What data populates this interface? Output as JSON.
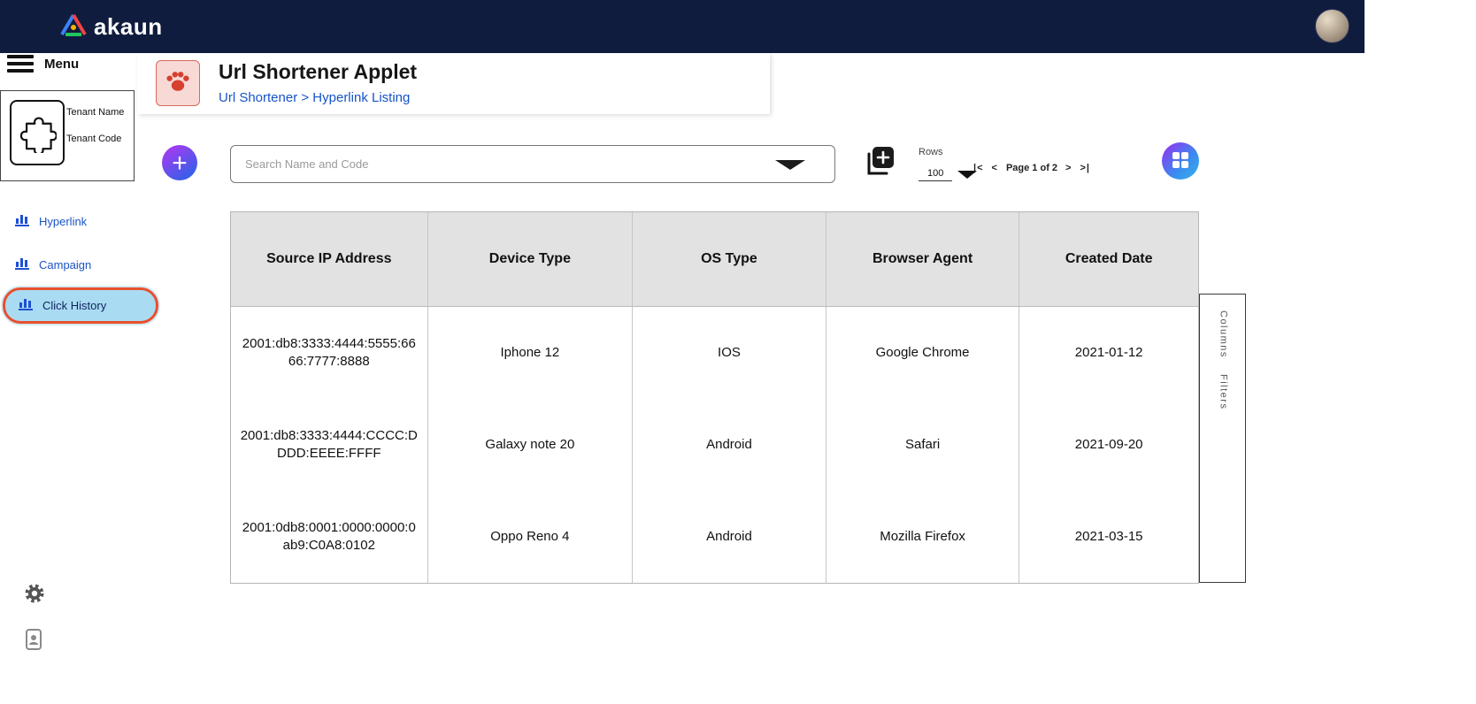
{
  "topbar": {
    "brand": "akaun"
  },
  "sidebar": {
    "menu_label": "Menu",
    "tenant": {
      "name_label": "Tenant Name",
      "code_label": "Tenant Code"
    },
    "items": [
      {
        "label": "Hyperlink",
        "active": false
      },
      {
        "label": "Campaign",
        "active": false
      },
      {
        "label": "Click History",
        "active": true
      }
    ]
  },
  "header": {
    "title": "Url Shortener Applet",
    "breadcrumb": "Url Shortener > Hyperlink Listing"
  },
  "toolbar": {
    "search_placeholder": "Search Name and Code",
    "rows_label": "Rows",
    "rows_value": "100"
  },
  "pagination": {
    "first": "|<",
    "prev": "<",
    "label": "Page 1 of 2",
    "next": ">",
    "last": ">|"
  },
  "table": {
    "columns": [
      "Source IP Address",
      "Device Type",
      "OS Type",
      "Browser Agent",
      "Created Date"
    ],
    "rows": [
      [
        "2001:db8:3333:4444:5555:6666:7777:8888",
        "Iphone 12",
        "IOS",
        "Google Chrome",
        "2021-01-12"
      ],
      [
        "2001:db8:3333:4444:CCCC:DDDD:EEEE:FFFF",
        "Galaxy note 20",
        "Android",
        "Safari",
        "2021-09-20"
      ],
      [
        "2001:0db8:0001:0000:0000:0ab9:C0A8:0102",
        "Oppo Reno 4",
        "Android",
        "Mozilla Firefox",
        "2021-03-15"
      ]
    ]
  },
  "side_panel": {
    "columns_label": "Columns",
    "filters_label": "Filters"
  },
  "colors": {
    "topbar_bg": "#101c3d",
    "link_blue": "#1553c8",
    "active_item_bg": "#a9dcf2",
    "active_item_border": "#e8502e",
    "accent_gradient_start": "#a03df0",
    "accent_gradient_end": "#2e62e8",
    "paw_bg": "#f8d9d6",
    "paw_red": "#d6402e"
  }
}
